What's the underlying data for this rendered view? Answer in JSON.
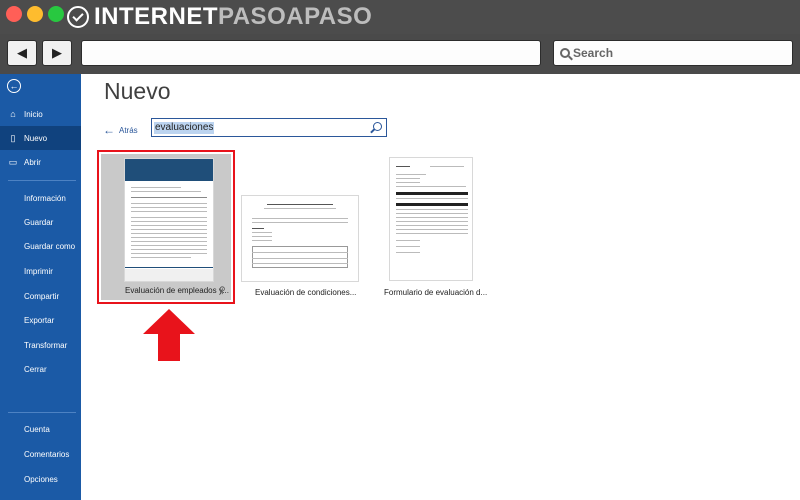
{
  "browser": {
    "logo_brand": "INTERNET",
    "logo_accent": "PASOAPASO",
    "search_placeholder": "Search",
    "back_icon": "◀",
    "forward_icon": "▶"
  },
  "sidebar": {
    "top_items": [
      {
        "label": "Inicio",
        "icon": "home-icon"
      },
      {
        "label": "Nuevo",
        "icon": "new-document-icon",
        "active": true
      },
      {
        "label": "Abrir",
        "icon": "folder-icon"
      }
    ],
    "mid_items": [
      "Información",
      "Guardar",
      "Guardar como",
      "Imprimir",
      "Compartir",
      "Exportar",
      "Transformar",
      "Cerrar"
    ],
    "bottom_items": [
      "Cuenta",
      "Comentarios",
      "Opciones"
    ]
  },
  "main": {
    "title": "Nuevo",
    "back_label": "Atrás",
    "search_value": "evaluaciones",
    "templates": [
      {
        "label": "Evaluación de empleados y...",
        "selected": true
      },
      {
        "label": "Evaluación de condiciones..."
      },
      {
        "label": "Formulario de evaluación d..."
      }
    ]
  },
  "colors": {
    "sidebar": "#1b5aa6",
    "sidebar_active": "#10427e",
    "highlight": "#e8131b",
    "accent": "#2b579a"
  }
}
